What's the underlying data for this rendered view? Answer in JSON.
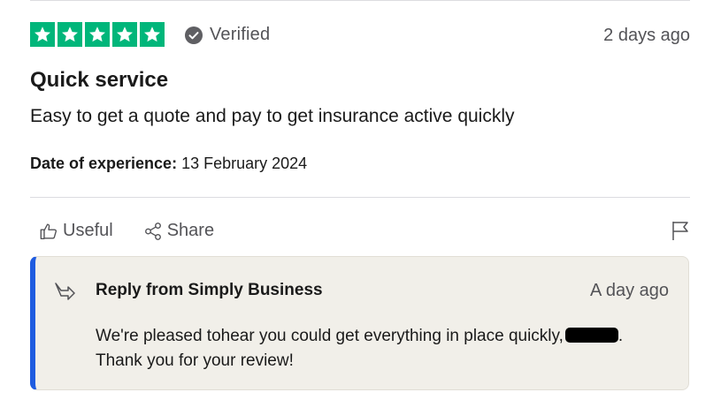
{
  "review": {
    "rating": 5,
    "verified_label": "Verified",
    "date": "2 days ago",
    "title": "Quick service",
    "body": "Easy to get a quote and pay to get insurance active quickly",
    "experience_label": "Date of experience:",
    "experience_date": "13 February 2024"
  },
  "actions": {
    "useful_label": "Useful",
    "share_label": "Share"
  },
  "reply": {
    "from": "Reply from Simply Business",
    "date": "A day ago",
    "text_line1": "We're pleased tohear you could get everything in place quickly,",
    "text_line1_end": ".",
    "text_line2": "Thank you for your review!"
  },
  "colors": {
    "star_green": "#00b67a",
    "reply_accent": "#1f5ce0",
    "reply_bg": "#f1efe9"
  }
}
